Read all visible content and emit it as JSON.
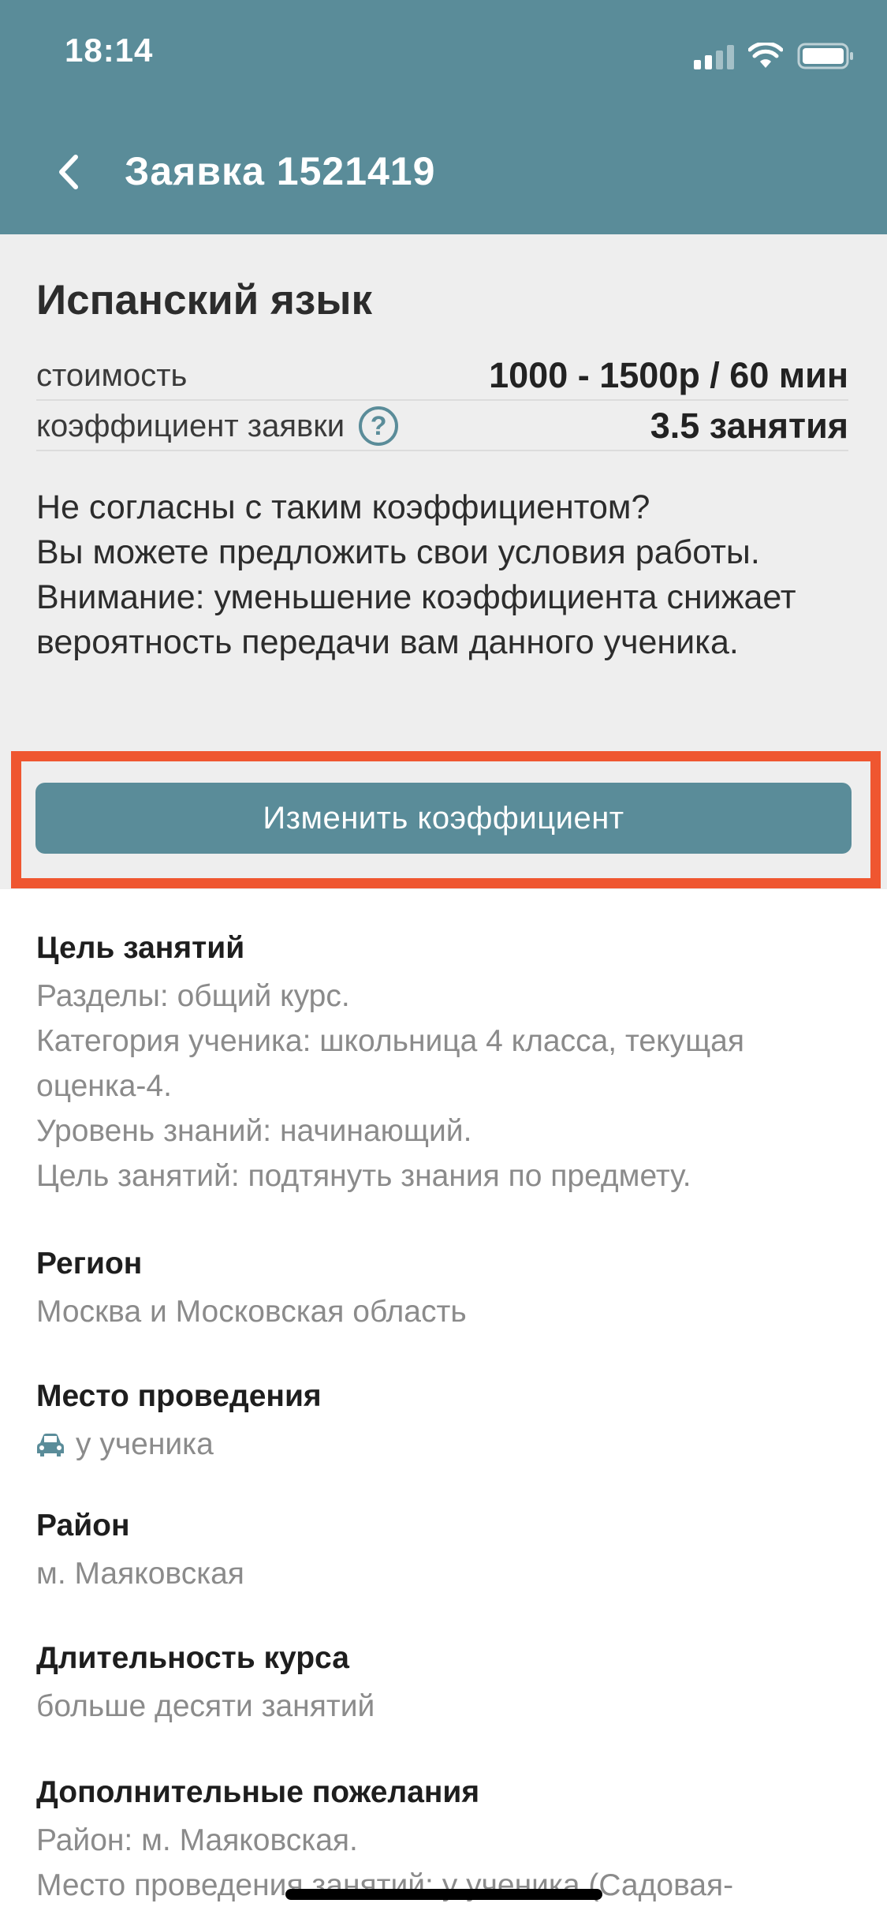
{
  "status_bar": {
    "time": "18:14"
  },
  "header": {
    "title": "Заявка 1521419"
  },
  "summary": {
    "subject": "Испанский язык",
    "price_label": "стоимость",
    "price_value": "1000 - 1500р / 60 мин",
    "coef_label": "коэффициент заявки",
    "coef_value": "3.5 занятия",
    "help_glyph": "?"
  },
  "notice": {
    "line1": "Не согласны с таким коэффициентом?",
    "line2": "Вы можете предложить свои условия работы.",
    "line3": "Внимание: уменьшение коэффициента снижает вероятность передачи вам данного ученика."
  },
  "change_button": {
    "label": "Изменить коэффициент"
  },
  "sections": {
    "goal": {
      "title": "Цель занятий",
      "lines": [
        "Разделы: общий курс.",
        "Категория ученика: школьница 4 класса, текущая оценка-4.",
        "Уровень знаний: начинающий.",
        "Цель занятий: подтянуть знания по предмету."
      ]
    },
    "region": {
      "title": "Регион",
      "value": "Москва и Московская область"
    },
    "place": {
      "title": "Место проведения",
      "value": "у ученика",
      "icon": "car-icon"
    },
    "district": {
      "title": "Район",
      "value": "м. Маяковская"
    },
    "duration": {
      "title": "Длительность курса",
      "value": "больше десяти занятий"
    },
    "wishes": {
      "title": "Дополнительные пожелания",
      "lines": [
        "Район: м. Маяковская.",
        "Место проведения занятий: у ученика (Садовая-"
      ]
    }
  },
  "colors": {
    "header_bg": "#5a8c99",
    "accent": "#5a8c99",
    "highlight": "#ef5630",
    "section_bg": "#eeeeee",
    "muted_text": "#8b8b8b"
  }
}
